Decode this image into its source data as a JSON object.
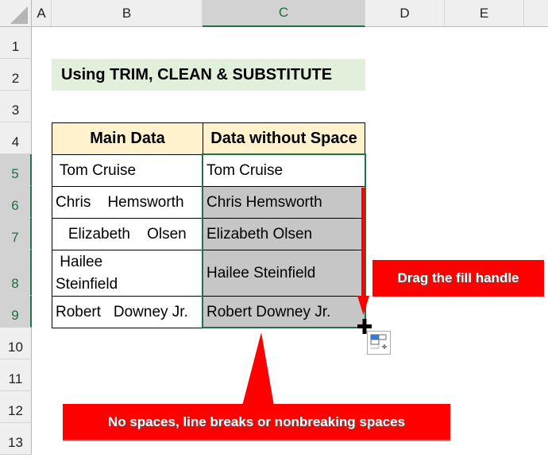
{
  "columns": [
    {
      "label": "A",
      "selected": false
    },
    {
      "label": "B",
      "selected": false
    },
    {
      "label": "C",
      "selected": true
    },
    {
      "label": "D",
      "selected": false
    },
    {
      "label": "E",
      "selected": false
    }
  ],
  "rows": [
    "1",
    "2",
    "3",
    "4",
    "5",
    "6",
    "7",
    "8",
    "9",
    "10",
    "11",
    "12",
    "13"
  ],
  "title": "Using TRIM, CLEAN & SUBSTITUTE",
  "table": {
    "headers": [
      "Main Data",
      "Data without Space"
    ],
    "rows": [
      {
        "main": " Tom Cruise",
        "clean": "Tom Cruise"
      },
      {
        "main": "Chris    Hemsworth",
        "clean": "Chris Hemsworth"
      },
      {
        "main": "   Elizabeth    Olsen",
        "clean": "Elizabeth Olsen"
      },
      {
        "main": " Hailee\nSteinfield",
        "clean": "Hailee Steinfield"
      },
      {
        "main": "Robert   Downey Jr.",
        "clean": "Robert Downey Jr."
      }
    ]
  },
  "callouts": {
    "fill_handle": "Drag the fill handle",
    "result_note": "No spaces, line breaks or nonbreaking spaces"
  },
  "icons": {
    "autofill_options": "auto-fill-options-icon",
    "fill_cursor": "crosshair-plus-icon"
  },
  "colors": {
    "selection": "#217346",
    "callout": "#ff0000",
    "title_bg": "#e2efda",
    "header_bg": "#fff2cc",
    "filled_bg": "#c6c6c6"
  }
}
